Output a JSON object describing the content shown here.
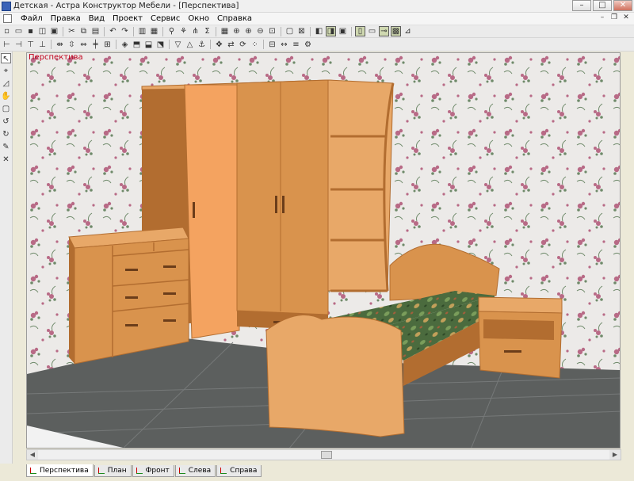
{
  "window": {
    "title": "Детская - Астра Конструктор Мебели - [Перспектива]",
    "controls": {
      "minimize": "–",
      "maximize": "□",
      "close": "✕"
    }
  },
  "menu": {
    "items": [
      "Файл",
      "Правка",
      "Вид",
      "Проект",
      "Сервис",
      "Окно",
      "Справка"
    ],
    "mdi_controls": {
      "minimize": "–",
      "restore": "❐",
      "close": "✕"
    }
  },
  "toolbar1": {
    "buttons": [
      {
        "icon": "new-doc-icon",
        "glyph": "▫"
      },
      {
        "icon": "open-icon",
        "glyph": "▭"
      },
      {
        "icon": "save-icon",
        "glyph": "▪"
      },
      {
        "icon": "print-preview-icon",
        "glyph": "◫"
      },
      {
        "icon": "print-icon",
        "glyph": "▣"
      },
      {
        "icon": "cut-icon",
        "glyph": "✂"
      },
      {
        "icon": "copy-icon",
        "glyph": "⧉"
      },
      {
        "icon": "paste-icon",
        "glyph": "▤"
      },
      {
        "icon": "undo-icon",
        "glyph": "↶"
      },
      {
        "icon": "redo-icon",
        "glyph": "↷"
      },
      {
        "icon": "panel-icon",
        "glyph": "▥"
      },
      {
        "icon": "image-icon",
        "glyph": "▦"
      },
      {
        "icon": "pin-icon",
        "glyph": "⚲"
      },
      {
        "icon": "fitting-icon",
        "glyph": "⚘"
      },
      {
        "icon": "tree-icon",
        "glyph": "⋔"
      },
      {
        "icon": "sum-icon",
        "glyph": "Σ"
      },
      {
        "icon": "grid-icon",
        "glyph": "▦"
      },
      {
        "icon": "zoom-fit-icon",
        "glyph": "⊕"
      },
      {
        "icon": "zoom-in-icon",
        "glyph": "⊕"
      },
      {
        "icon": "zoom-out-icon",
        "glyph": "⊖"
      },
      {
        "icon": "zoom-window-icon",
        "glyph": "⊡"
      },
      {
        "icon": "frame-icon",
        "glyph": "▢"
      },
      {
        "icon": "box-x-icon",
        "glyph": "⊠"
      },
      {
        "icon": "cube-icon",
        "glyph": "◧"
      },
      {
        "icon": "cube-wire-icon",
        "glyph": "◨"
      },
      {
        "icon": "cube-solid-icon",
        "glyph": "▣"
      },
      {
        "icon": "door-icon",
        "glyph": "▯"
      },
      {
        "icon": "drawer-icon",
        "glyph": "▭"
      },
      {
        "icon": "handle-icon",
        "glyph": "⊸"
      },
      {
        "icon": "texture-icon",
        "glyph": "▩"
      },
      {
        "icon": "measure-icon",
        "glyph": "⊿"
      }
    ]
  },
  "toolbar2": {
    "buttons": [
      {
        "icon": "align-left-icon",
        "glyph": "⊢"
      },
      {
        "icon": "align-right-icon",
        "glyph": "⊣"
      },
      {
        "icon": "align-top-icon",
        "glyph": "⊤"
      },
      {
        "icon": "align-bottom-icon",
        "glyph": "⊥"
      },
      {
        "icon": "space-h-icon",
        "glyph": "⇹"
      },
      {
        "icon": "space-v-icon",
        "glyph": "⇳"
      },
      {
        "icon": "stretch-icon",
        "glyph": "⇔"
      },
      {
        "icon": "center-icon",
        "glyph": "╪"
      },
      {
        "icon": "fit-icon",
        "glyph": "⊞"
      },
      {
        "icon": "box-icon",
        "glyph": "◈"
      },
      {
        "icon": "cabinet-icon",
        "glyph": "⬒"
      },
      {
        "icon": "shelf-icon",
        "glyph": "⬓"
      },
      {
        "icon": "top-view-icon",
        "glyph": "⬔"
      },
      {
        "icon": "funnel-icon",
        "glyph": "▽"
      },
      {
        "icon": "arrow-up-icon",
        "glyph": "△"
      },
      {
        "icon": "hook-icon",
        "glyph": "⚓"
      },
      {
        "icon": "move-icon",
        "glyph": "✥"
      },
      {
        "icon": "mirror-icon",
        "glyph": "⇄"
      },
      {
        "icon": "rotate-icon",
        "glyph": "⟳"
      },
      {
        "icon": "array-icon",
        "glyph": "⁘"
      },
      {
        "icon": "section-icon",
        "glyph": "⊟"
      },
      {
        "icon": "dimension-icon",
        "glyph": "↔"
      },
      {
        "icon": "layer-icon",
        "glyph": "≡"
      },
      {
        "icon": "props-icon",
        "glyph": "⚙"
      }
    ]
  },
  "left_tools": [
    {
      "icon": "select-arrow-icon",
      "glyph": "↖"
    },
    {
      "icon": "point-icon",
      "glyph": "⌖"
    },
    {
      "icon": "node-icon",
      "glyph": "◿"
    },
    {
      "icon": "pan-icon",
      "glyph": "✋"
    },
    {
      "icon": "rect-select-icon",
      "glyph": "▢"
    },
    {
      "icon": "rotate-left-icon",
      "glyph": "↺"
    },
    {
      "icon": "rotate-right-icon",
      "glyph": "↻"
    },
    {
      "icon": "brush-icon",
      "glyph": "✎"
    },
    {
      "icon": "delete-icon",
      "glyph": "✕"
    }
  ],
  "viewport": {
    "label": "Перспектива",
    "colors": {
      "wallpaper": "#eceae8",
      "wood": "#d9934d",
      "wood_light": "#e8a868",
      "wood_dark": "#b26d30",
      "open_door": "#f4a360",
      "floor": "#5c5f5e",
      "floor_light": "#767979",
      "bedspread": "#4b6b3e",
      "flower_pink": "#b86a86",
      "leaf_green": "#6f8a6a",
      "handle": "#6b3d1a"
    }
  },
  "tabs": [
    {
      "label": "Перспектива",
      "active": true
    },
    {
      "label": "План",
      "active": false
    },
    {
      "label": "Фронт",
      "active": false
    },
    {
      "label": "Слева",
      "active": false
    },
    {
      "label": "Справа",
      "active": false
    }
  ]
}
